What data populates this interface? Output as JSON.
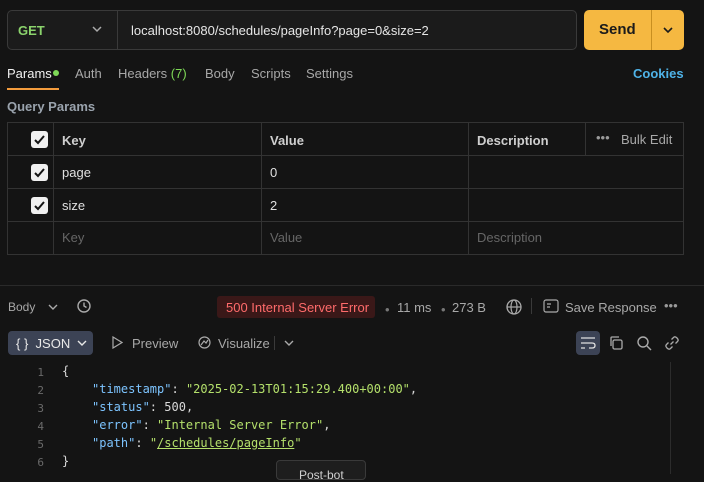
{
  "request": {
    "method": "GET",
    "url": "localhost:8080/schedules/pageInfo?page=0&size=2",
    "send_label": "Send"
  },
  "tabs": {
    "params": "Params",
    "auth": "Auth",
    "headers": "Headers",
    "headers_count": "(7)",
    "body": "Body",
    "scripts": "Scripts",
    "settings": "Settings",
    "cookies": "Cookies"
  },
  "query_params": {
    "title": "Query Params",
    "columns": {
      "key": "Key",
      "value": "Value",
      "description": "Description",
      "bulk_edit": "Bulk Edit"
    },
    "rows": [
      {
        "checked": true,
        "key": "page",
        "value": "0",
        "description": ""
      },
      {
        "checked": true,
        "key": "size",
        "value": "2",
        "description": ""
      }
    ],
    "placeholder": {
      "key": "Key",
      "value": "Value",
      "description": "Description"
    }
  },
  "response": {
    "body_label": "Body",
    "status": "500 Internal Server Error",
    "time": "11 ms",
    "size": "273 B",
    "save_label": "Save Response",
    "format_label": "JSON",
    "preview_label": "Preview",
    "visualize_label": "Visualize",
    "line_numbers": [
      "1",
      "2",
      "3",
      "4",
      "5",
      "6"
    ],
    "json": {
      "timestamp_key": "\"timestamp\"",
      "timestamp_val": "\"2025-02-13T01:15:29.400+00:00\"",
      "status_key": "\"status\"",
      "status_val": "500",
      "error_key": "\"error\"",
      "error_val": "\"Internal Server Error\"",
      "path_key": "\"path\"",
      "path_val": "/schedules/pageInfo",
      "open_brace": "{",
      "close_brace": "}"
    },
    "tooltip": "Post-bot"
  },
  "colors": {
    "accent": "#f5b841",
    "method": "#8bd36c",
    "error": "#ff6b6b",
    "link": "#4fb3e8"
  }
}
